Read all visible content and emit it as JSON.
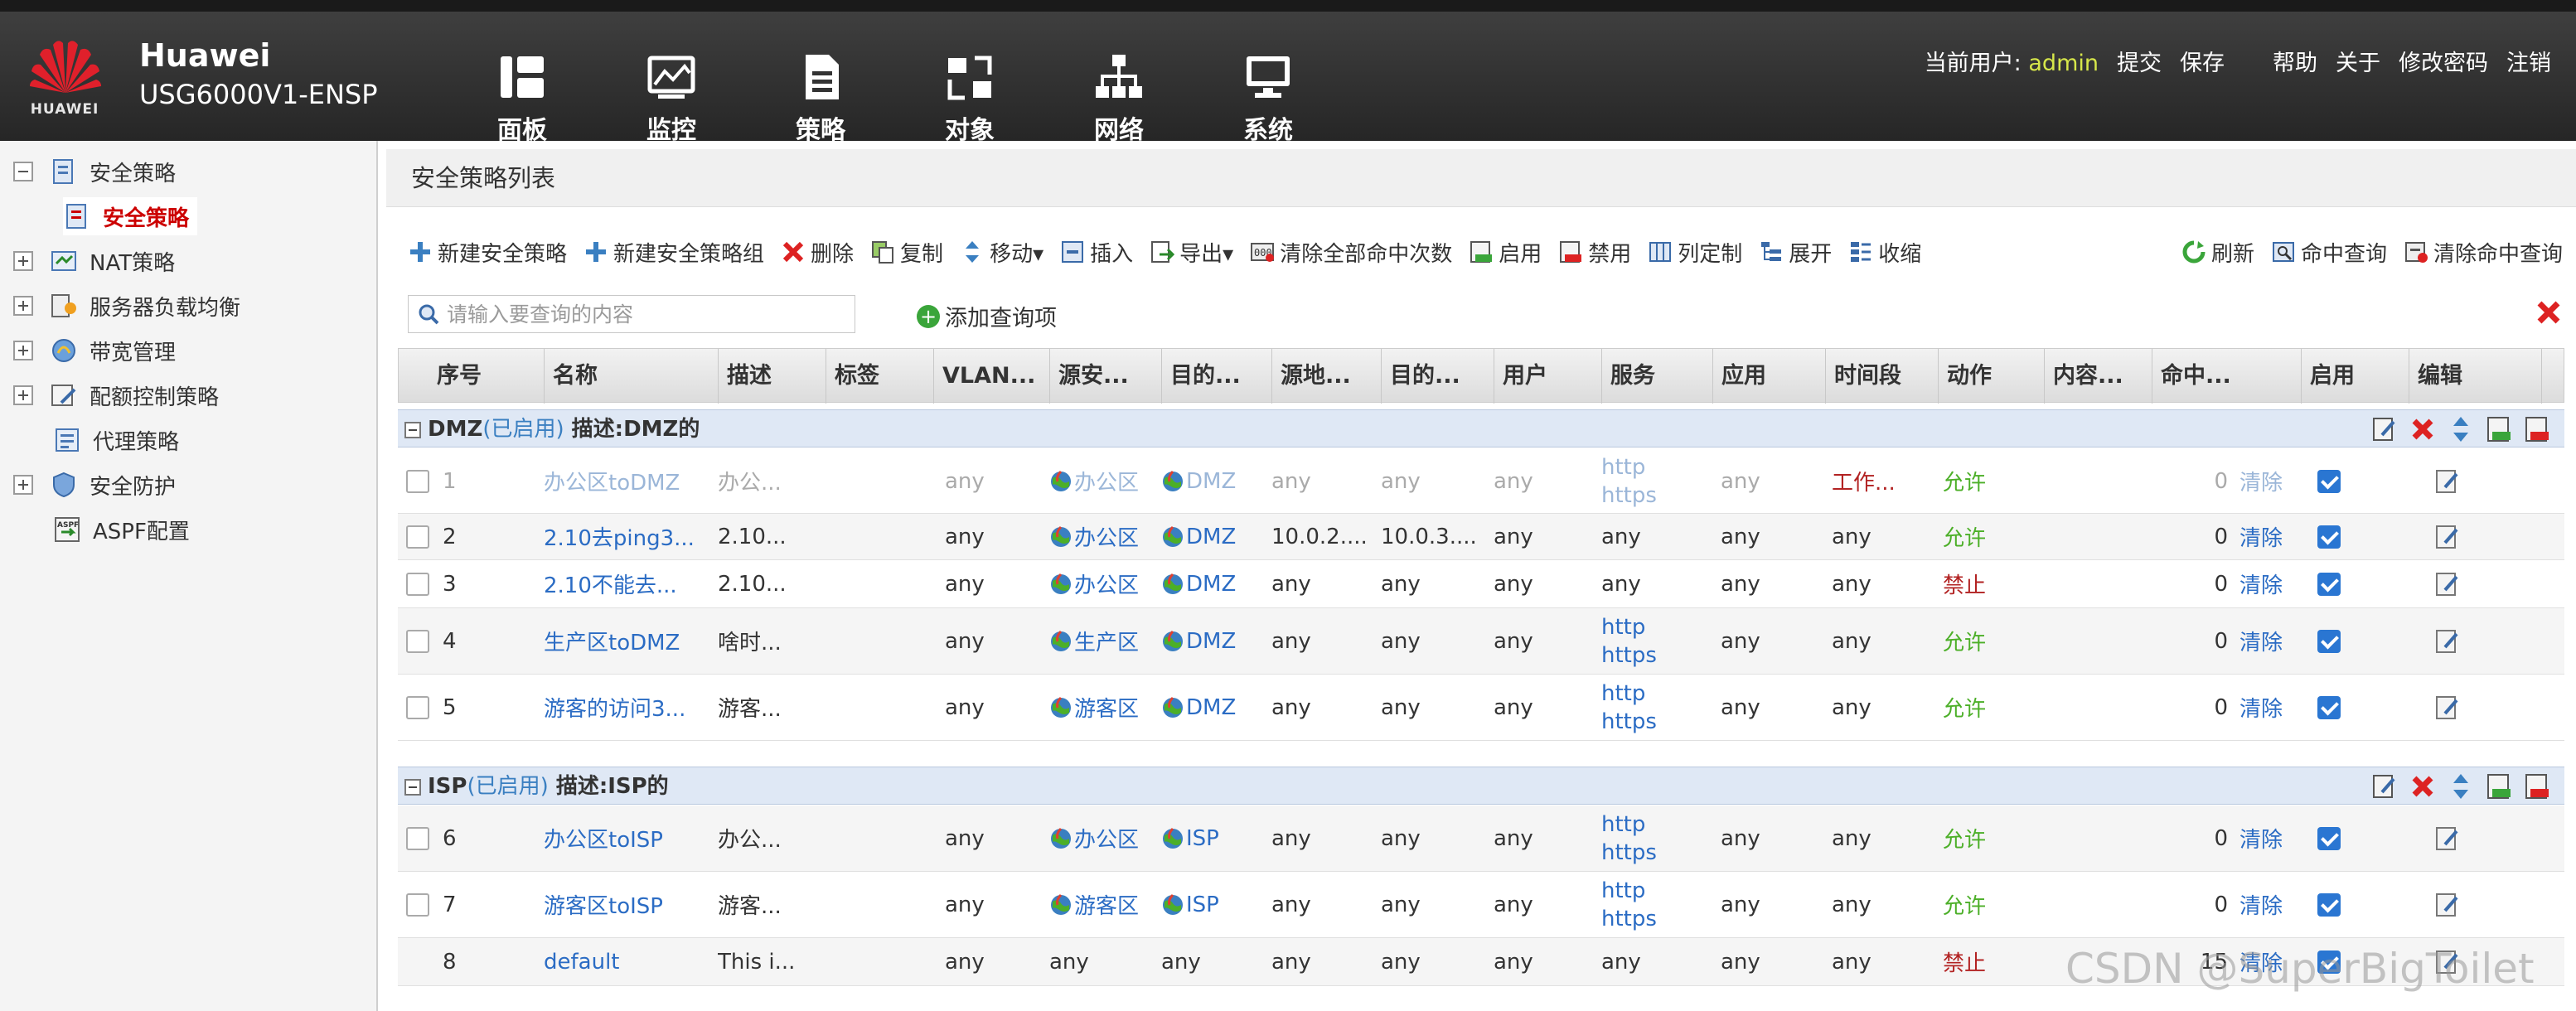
{
  "brand": {
    "logo_text": "HUAWEI",
    "name": "Huawei",
    "model": "USG6000V1-ENSP"
  },
  "nav": [
    {
      "label": "面板",
      "icon": "dashboard-icon"
    },
    {
      "label": "监控",
      "icon": "monitor-icon"
    },
    {
      "label": "策略",
      "icon": "policy-icon"
    },
    {
      "label": "对象",
      "icon": "object-icon"
    },
    {
      "label": "网络",
      "icon": "network-icon"
    },
    {
      "label": "系统",
      "icon": "system-icon"
    }
  ],
  "topbar": {
    "user_label": "当前用户:",
    "user": "admin",
    "submit": "提交",
    "save": "保存",
    "help": "帮助",
    "about": "关于",
    "change_password": "修改密码",
    "logout": "注销"
  },
  "sidebar": {
    "items": [
      {
        "label": "安全策略",
        "expanded": true
      },
      {
        "label": "安全策略",
        "selected": true
      },
      {
        "label": "NAT策略"
      },
      {
        "label": "服务器负载均衡"
      },
      {
        "label": "带宽管理"
      },
      {
        "label": "配额控制策略"
      },
      {
        "label": "代理策略"
      },
      {
        "label": "安全防护"
      },
      {
        "label": "ASPF配置"
      }
    ]
  },
  "panel": {
    "title": "安全策略列表"
  },
  "toolbar": {
    "new_policy": "新建安全策略",
    "new_group": "新建安全策略组",
    "delete": "删除",
    "copy": "复制",
    "move": "移动▾",
    "insert": "插入",
    "export": "导出▾",
    "clear_hits": "清除全部命中次数",
    "enable": "启用",
    "disable": "禁用",
    "columns": "列定制",
    "expand": "展开",
    "collapse": "收缩",
    "refresh": "刷新",
    "hit_query": "命中查询",
    "clear_hit_query": "清除命中查询"
  },
  "search": {
    "placeholder": "请输入要查询的内容",
    "add_query": "添加查询项"
  },
  "table": {
    "headers": [
      "序号",
      "名称",
      "描述",
      "标签",
      "VLAN...",
      "源安...",
      "目的...",
      "源地...",
      "目的...",
      "用户",
      "服务",
      "应用",
      "时间段",
      "动作",
      "内容...",
      "命中...",
      "启用",
      "编辑"
    ],
    "groups": [
      {
        "name": "DMZ",
        "state": "(已启用)",
        "desc": "描述:DMZ的"
      },
      {
        "name": "ISP",
        "state": "(已启用)",
        "desc": "描述:ISP的"
      }
    ],
    "rows": [
      {
        "id": "1",
        "name": "办公区toDMZ",
        "desc": "办公...",
        "vlan": "any",
        "src_zone": "办公区",
        "dst_zone": "DMZ",
        "src_addr": "any",
        "dst_addr": "any",
        "user": "any",
        "service": [
          "http",
          "https"
        ],
        "app": "any",
        "time": "工作...",
        "action": "允许",
        "hits": "0",
        "clear": "清除",
        "enabled": true
      },
      {
        "id": "2",
        "name": "2.10去ping3...",
        "desc": "2.10...",
        "vlan": "any",
        "src_zone": "办公区",
        "dst_zone": "DMZ",
        "src_addr": "10.0.2....",
        "dst_addr": "10.0.3....",
        "user": "any",
        "service": [
          "any"
        ],
        "app": "any",
        "time": "any",
        "action": "允许",
        "hits": "0",
        "clear": "清除",
        "enabled": true
      },
      {
        "id": "3",
        "name": "2.10不能去...",
        "desc": "2.10...",
        "vlan": "any",
        "src_zone": "办公区",
        "dst_zone": "DMZ",
        "src_addr": "any",
        "dst_addr": "any",
        "user": "any",
        "service": [
          "any"
        ],
        "app": "any",
        "time": "any",
        "action": "禁止",
        "hits": "0",
        "clear": "清除",
        "enabled": true
      },
      {
        "id": "4",
        "name": "生产区toDMZ",
        "desc": "啥时...",
        "vlan": "any",
        "src_zone": "生产区",
        "dst_zone": "DMZ",
        "src_addr": "any",
        "dst_addr": "any",
        "user": "any",
        "service": [
          "http",
          "https"
        ],
        "app": "any",
        "time": "any",
        "action": "允许",
        "hits": "0",
        "clear": "清除",
        "enabled": true
      },
      {
        "id": "5",
        "name": "游客的访问3...",
        "desc": "游客...",
        "vlan": "any",
        "src_zone": "游客区",
        "dst_zone": "DMZ",
        "src_addr": "any",
        "dst_addr": "any",
        "user": "any",
        "service": [
          "http",
          "https"
        ],
        "app": "any",
        "time": "any",
        "action": "允许",
        "hits": "0",
        "clear": "清除",
        "enabled": true
      },
      {
        "id": "6",
        "name": "办公区toISP",
        "desc": "办公...",
        "vlan": "any",
        "src_zone": "办公区",
        "dst_zone": "ISP",
        "src_addr": "any",
        "dst_addr": "any",
        "user": "any",
        "service": [
          "http",
          "https"
        ],
        "app": "any",
        "time": "any",
        "action": "允许",
        "hits": "0",
        "clear": "清除",
        "enabled": true
      },
      {
        "id": "7",
        "name": "游客区toISP",
        "desc": "游客...",
        "vlan": "any",
        "src_zone": "游客区",
        "dst_zone": "ISP",
        "src_addr": "any",
        "dst_addr": "any",
        "user": "any",
        "service": [
          "http",
          "https"
        ],
        "app": "any",
        "time": "any",
        "action": "允许",
        "hits": "0",
        "clear": "清除",
        "enabled": true
      },
      {
        "id": "8",
        "name": "default",
        "desc": "This i...",
        "vlan": "any",
        "src_zone": "any",
        "dst_zone": "any",
        "src_addr": "any",
        "dst_addr": "any",
        "user": "any",
        "service": [
          "any"
        ],
        "app": "any",
        "time": "any",
        "action": "禁止",
        "hits": "15",
        "clear": "清除",
        "enabled": true
      }
    ]
  },
  "watermark": "CSDN @SuperBigToilet",
  "colors": {
    "header_bg": "#2e2e2e",
    "link": "#2b6cc4",
    "allow": "#4caf28",
    "deny": "#b22222",
    "group_bg": "#dfe8f5",
    "checkbox": "#2a76d2"
  }
}
